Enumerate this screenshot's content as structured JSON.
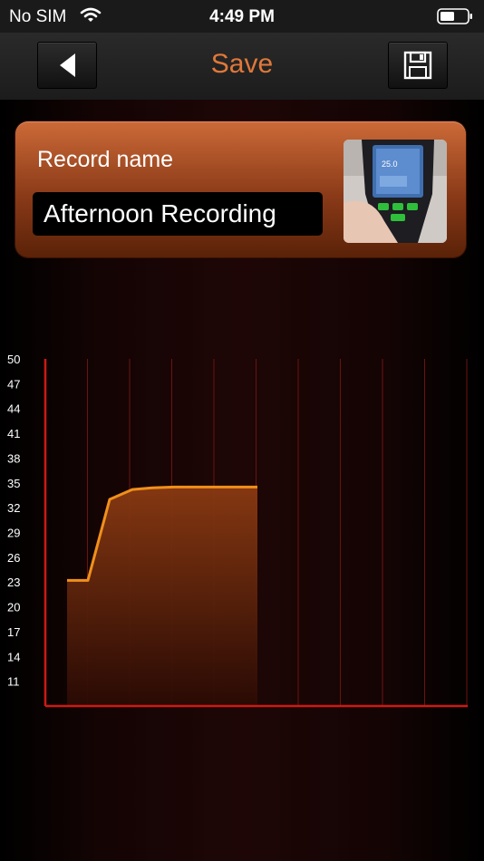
{
  "status_bar": {
    "carrier": "No SIM",
    "time": "4:49 PM"
  },
  "nav": {
    "title": "Save",
    "back_icon": "back-arrow-icon",
    "save_icon": "floppy-disk-icon",
    "accent_color": "#e0783a"
  },
  "record": {
    "label": "Record name",
    "name_value": "Afternoon Recording",
    "photo_icon": "thermometer-photo-thumbnail"
  },
  "chart_data": {
    "type": "area",
    "y_tick_labels": [
      "50",
      "47",
      "44",
      "41",
      "38",
      "35",
      "32",
      "29",
      "26",
      "23",
      "20",
      "17",
      "14",
      "11"
    ],
    "ylim": [
      8,
      50
    ],
    "x": [
      0,
      1,
      2,
      3,
      4,
      5,
      6,
      7,
      8,
      9
    ],
    "values": [
      23.2,
      23.2,
      33.0,
      34.2,
      34.4,
      34.5,
      34.5,
      34.5,
      34.5,
      34.5
    ],
    "line_color": "#f0901a",
    "axis_color": "#cc1a12",
    "grid": true
  }
}
